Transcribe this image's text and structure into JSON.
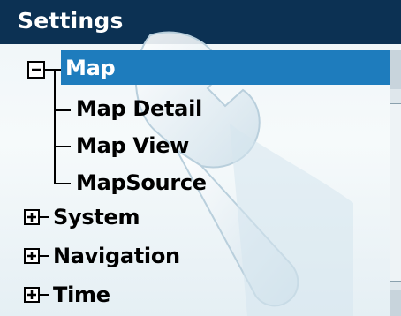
{
  "window": {
    "title": "Settings"
  },
  "tree": {
    "selected": "Map",
    "items": [
      {
        "label": "Map",
        "expanded": true,
        "selected": true
      },
      {
        "label": "Map Detail",
        "child_of": "Map"
      },
      {
        "label": "Map View",
        "child_of": "Map"
      },
      {
        "label": "MapSource",
        "child_of": "Map"
      },
      {
        "label": "System",
        "expanded": false
      },
      {
        "label": "Navigation",
        "expanded": false
      },
      {
        "label": "Time",
        "expanded": false
      }
    ]
  },
  "icons": {
    "collapse": "minus-box-icon",
    "expand": "plus-box-icon",
    "background": "wrench-icon"
  },
  "colors": {
    "title_bar": "#0c3153",
    "selection": "#1e7cbd",
    "background": "#eef5f8"
  }
}
